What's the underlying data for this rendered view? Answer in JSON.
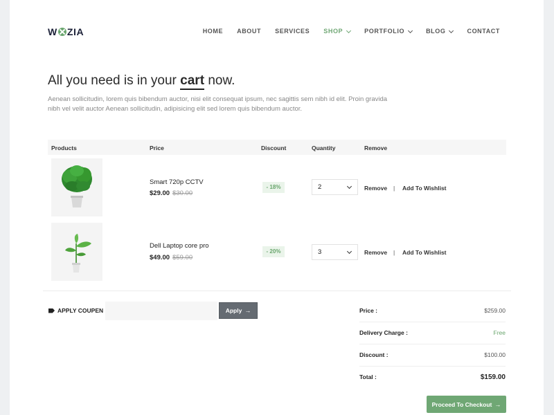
{
  "header": {
    "logo_left": "W",
    "logo_right": "ZIA",
    "nav": [
      {
        "label": "HOME",
        "dropdown": false,
        "active": false
      },
      {
        "label": "ABOUT",
        "dropdown": false,
        "active": false
      },
      {
        "label": "SERVICES",
        "dropdown": false,
        "active": false
      },
      {
        "label": "SHOP",
        "dropdown": true,
        "active": true
      },
      {
        "label": "PORTFOLIO",
        "dropdown": true,
        "active": false
      },
      {
        "label": "BLOG",
        "dropdown": true,
        "active": false
      },
      {
        "label": "CONTACT",
        "dropdown": false,
        "active": false
      }
    ]
  },
  "hero": {
    "headline_before": "All you need is in your",
    "headline_emphasis": "cart",
    "headline_after": "now.",
    "intro": "Aenean sollicitudin, lorem quis bibendum auctor, nisi elit consequat ipsum, nec sagittis sem nibh id elit. Proin gravida nibh vel velit auctor Aenean sollicitudin, adipisicing elit sed lorem quis bibendum auctor."
  },
  "cart": {
    "columns": [
      "Products",
      "Price",
      "Discount",
      "Quantity",
      "Remove"
    ],
    "items": [
      {
        "name": "Smart 720p CCTV",
        "price": "$29.00",
        "old_price": "$30.00",
        "discount": "- 18%",
        "quantity": "2",
        "remove_label": "Remove",
        "separator": "|",
        "wishlist_label": "Add To Wishlist",
        "image_icon": "monstera-plant-icon"
      },
      {
        "name": "Dell Laptop core pro",
        "price": "$49.00",
        "old_price": "$59.00",
        "discount": "- 20%",
        "quantity": "3",
        "remove_label": "Remove",
        "separator": "|",
        "wishlist_label": "Add To Wishlist",
        "image_icon": "sprout-plant-icon"
      }
    ]
  },
  "coupon": {
    "label": "APPLY COUPEN",
    "placeholder": "",
    "apply_label": "Apply",
    "arrow": "→"
  },
  "summary": {
    "rows": [
      {
        "label": "Price :",
        "value": "$259.00"
      },
      {
        "label": "Delivery Charge :",
        "value": "Free"
      },
      {
        "label": "Discount :",
        "value": "$100.00"
      },
      {
        "label": "Total :",
        "value": "$159.00"
      }
    ],
    "checkout_label": "Proceed To Checkout",
    "checkout_arrow": "→"
  },
  "colors": {
    "accent": "#6fa774",
    "discount_bg": "#eaf4ea",
    "apply_button": "#656b72",
    "page_bg": "#eef0f2"
  }
}
